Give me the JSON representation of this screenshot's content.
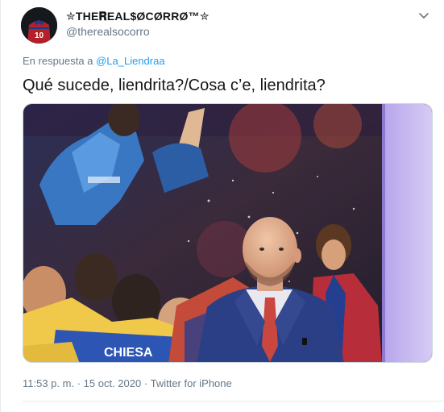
{
  "author": {
    "display_name": "✮THE𝐑EAL$ØCØRRØ™✮",
    "handle": "@therealsocorro",
    "avatar_jersey_number": "10"
  },
  "reply": {
    "prefix": "En respuesta a",
    "to_handle": "@La_Liendraa"
  },
  "tweet": {
    "text": "Qué sucede, liendrita?/Cosa c’e, liendrita?"
  },
  "media": {
    "jersey_text": "CHIESA"
  },
  "meta": {
    "time": "11:53 p. m.",
    "separator1": "·",
    "date": "15 oct. 2020",
    "separator2": "·",
    "source": "Twitter for iPhone"
  },
  "colors": {
    "link": "#1da1f2",
    "secondary_text": "#657786",
    "border": "#e6ecf0"
  },
  "icons": {
    "more": "chevron-down-icon"
  }
}
